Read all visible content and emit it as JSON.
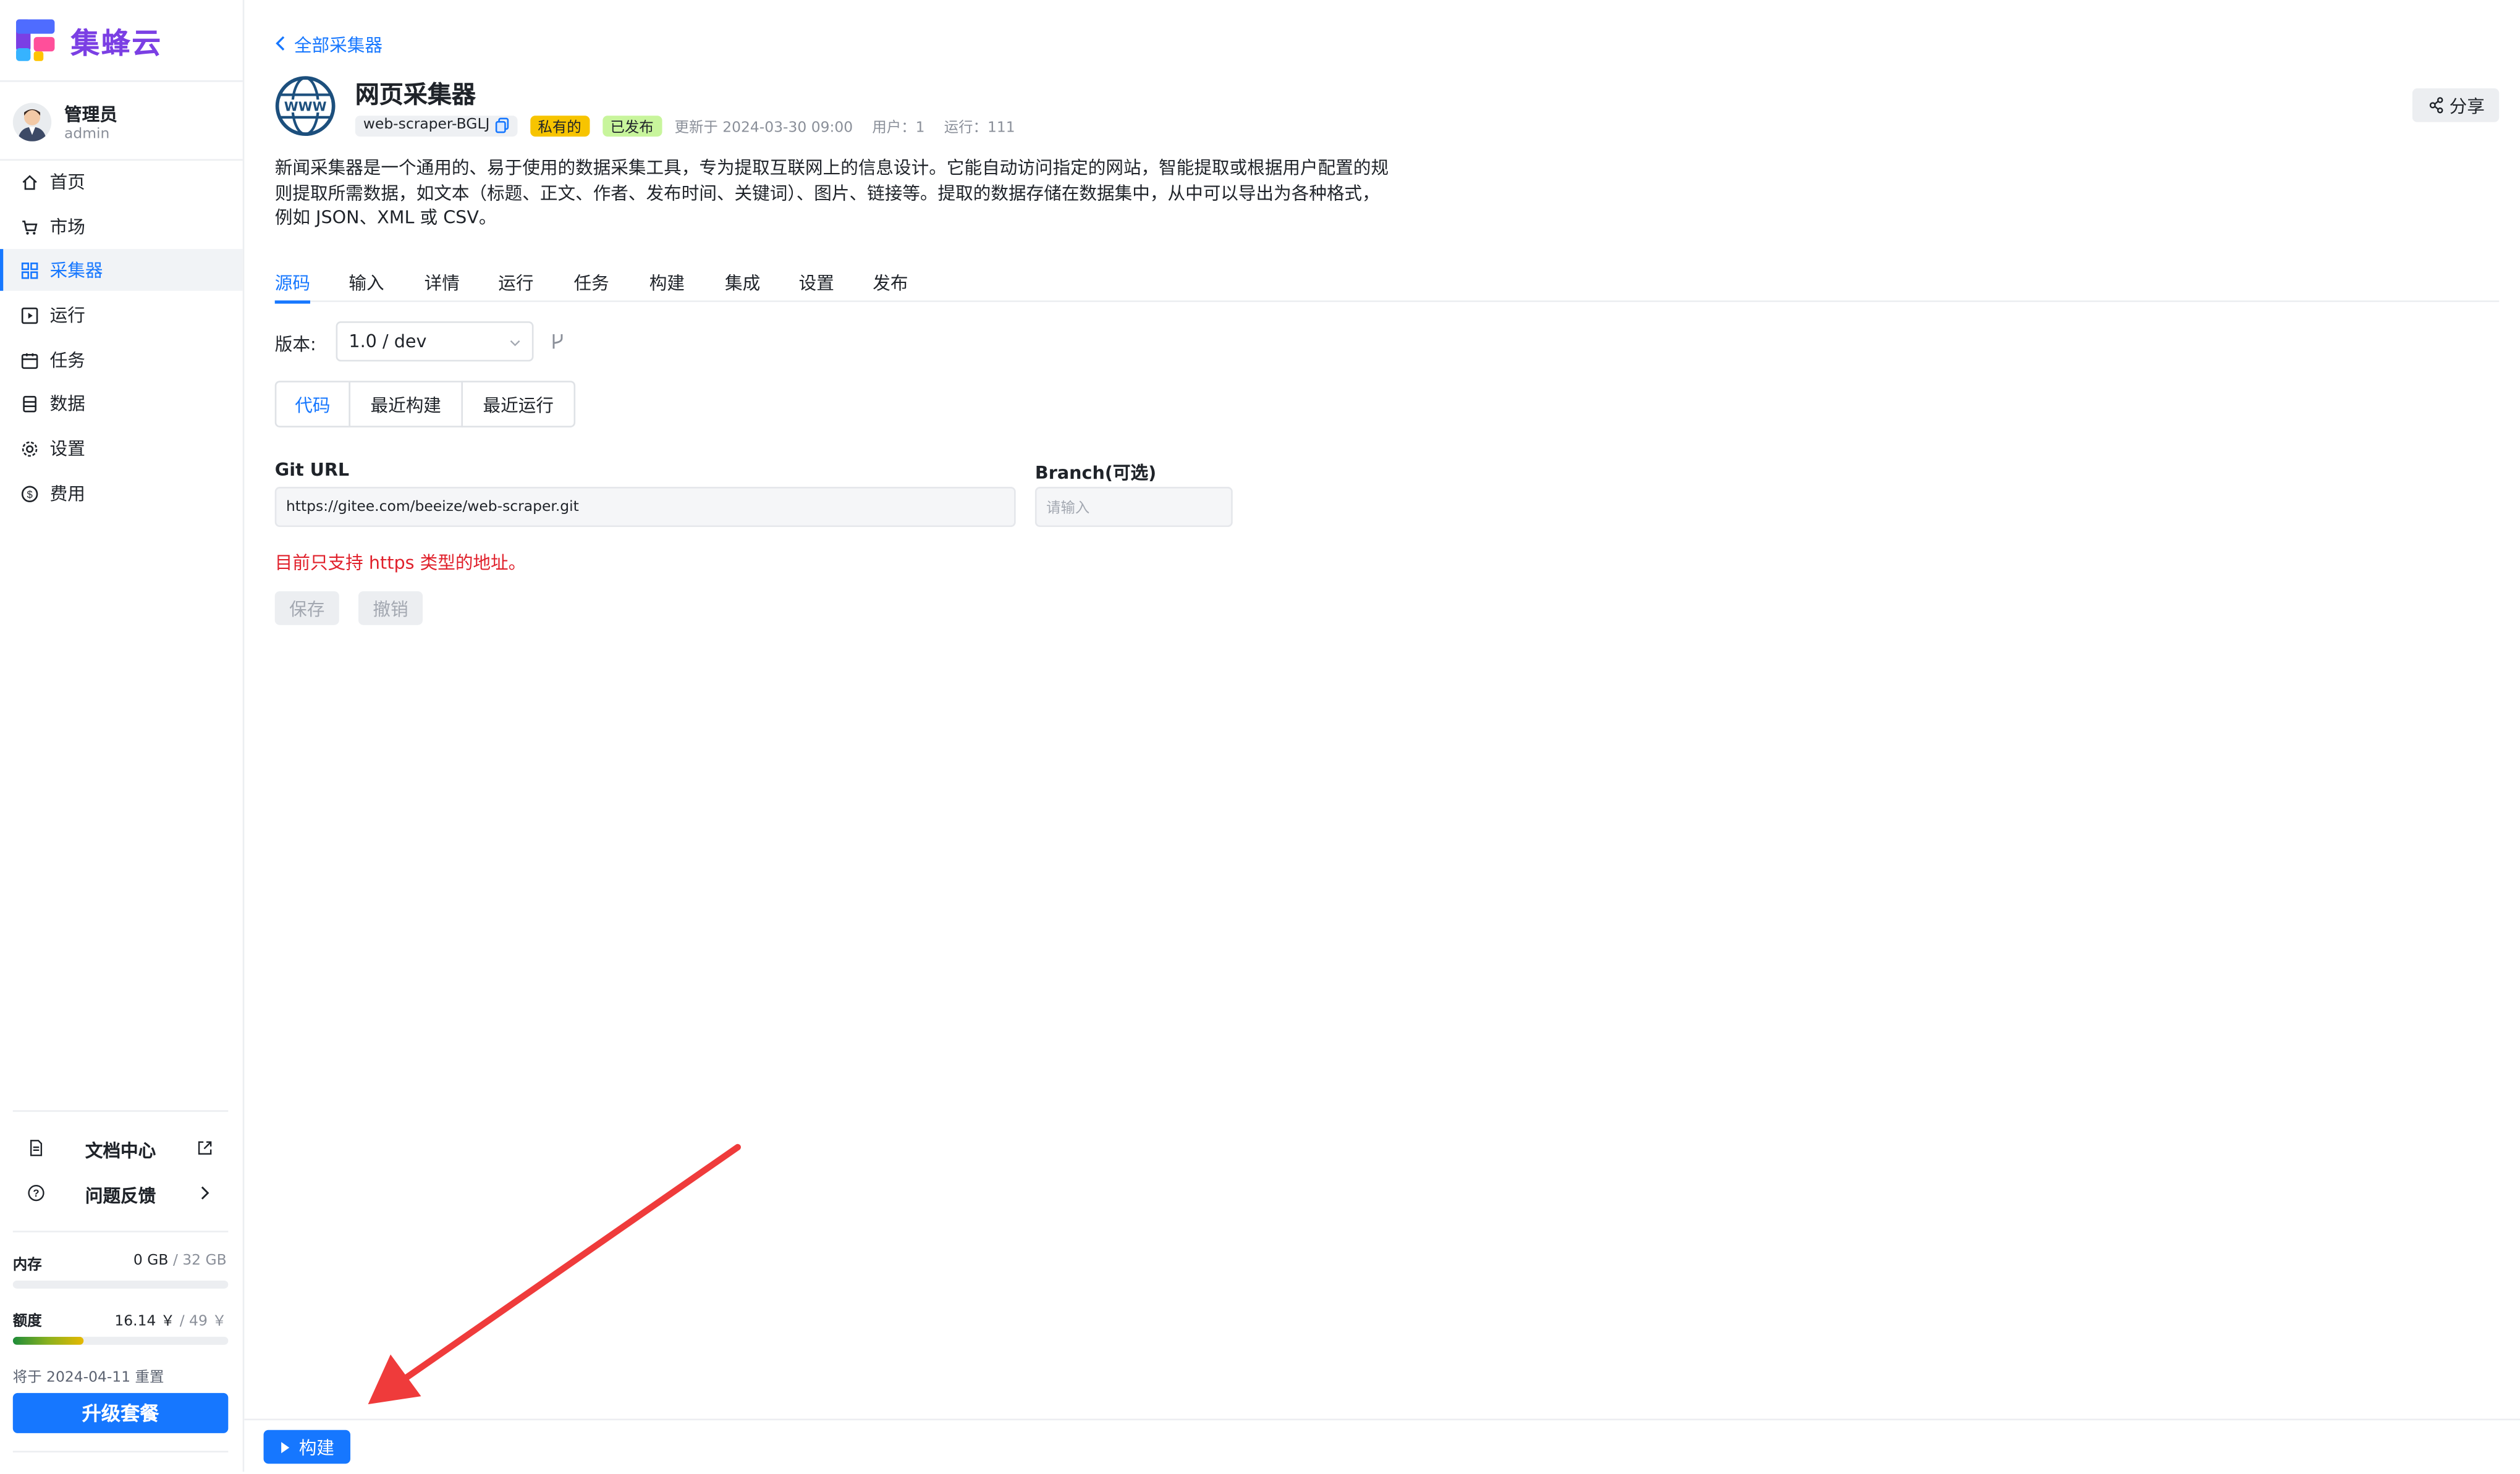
{
  "app": {
    "name": "集蜂云"
  },
  "user": {
    "name": "管理员",
    "role": "admin"
  },
  "nav": {
    "items": [
      {
        "label": "首页",
        "icon": "home-icon"
      },
      {
        "label": "市场",
        "icon": "cart-icon"
      },
      {
        "label": "采集器",
        "icon": "grid-icon",
        "active": true
      },
      {
        "label": "运行",
        "icon": "play-square-icon"
      },
      {
        "label": "任务",
        "icon": "calendar-icon"
      },
      {
        "label": "数据",
        "icon": "database-icon"
      },
      {
        "label": "设置",
        "icon": "gear-icon"
      },
      {
        "label": "费用",
        "icon": "dollar-circle-icon"
      }
    ]
  },
  "footer": {
    "docs_label": "文档中心",
    "feedback_label": "问题反馈",
    "memory_label": "内存",
    "memory_used": "0 GB",
    "memory_total": "/ 32 GB",
    "memory_fraction": 0,
    "quota_label": "额度",
    "quota_used": "16.14 ￥",
    "quota_total": "/ 49 ￥",
    "quota_fraction": 0.33,
    "reset_note": "将于 2024-04-11 重置",
    "upgrade_label": "升级套餐"
  },
  "main": {
    "back_label": "全部采集器",
    "title": "网页采集器",
    "id_chip": "web-scraper-BGLJ",
    "private_chip": "私有的",
    "published_chip": "已发布",
    "updated": "更新于 2024-03-30 09:00",
    "users": "用户：1",
    "runs": "运行：111",
    "share_label": "分享",
    "description": "新闻采集器是一个通用的、易于使用的数据采集工具，专为提取互联网上的信息设计。它能自动访问指定的网站，智能提取或根据用户配置的规则提取所需数据，如文本（标题、正文、作者、发布时间、关键词）、图片、链接等。提取的数据存储在数据集中，从中可以导出为各种格式， 例如 JSON、XML 或 CSV。",
    "tabs": [
      "源码",
      "输入",
      "详情",
      "运行",
      "任务",
      "构建",
      "集成",
      "设置",
      "发布"
    ],
    "version_label": "版本:",
    "version_value": "1.0 / dev",
    "segments": [
      "代码",
      "最近构建",
      "最近运行"
    ],
    "git_url_label": "Git URL",
    "git_url_value": "https://gitee.com/beeize/web-scraper.git",
    "branch_label": "Branch(可选)",
    "branch_placeholder": "请输入",
    "warning": "目前只支持 https 类型的地址。",
    "save_label": "保存",
    "cancel_label": "撤销",
    "build_label": "构建"
  },
  "colors": {
    "accent": "#1677ff",
    "brand": "#7b3fe4",
    "warning": "#e0202b",
    "private_chip": "#f7c400",
    "published_chip": "#c8f59c",
    "annotation_arrow": "#ef3b3b"
  }
}
